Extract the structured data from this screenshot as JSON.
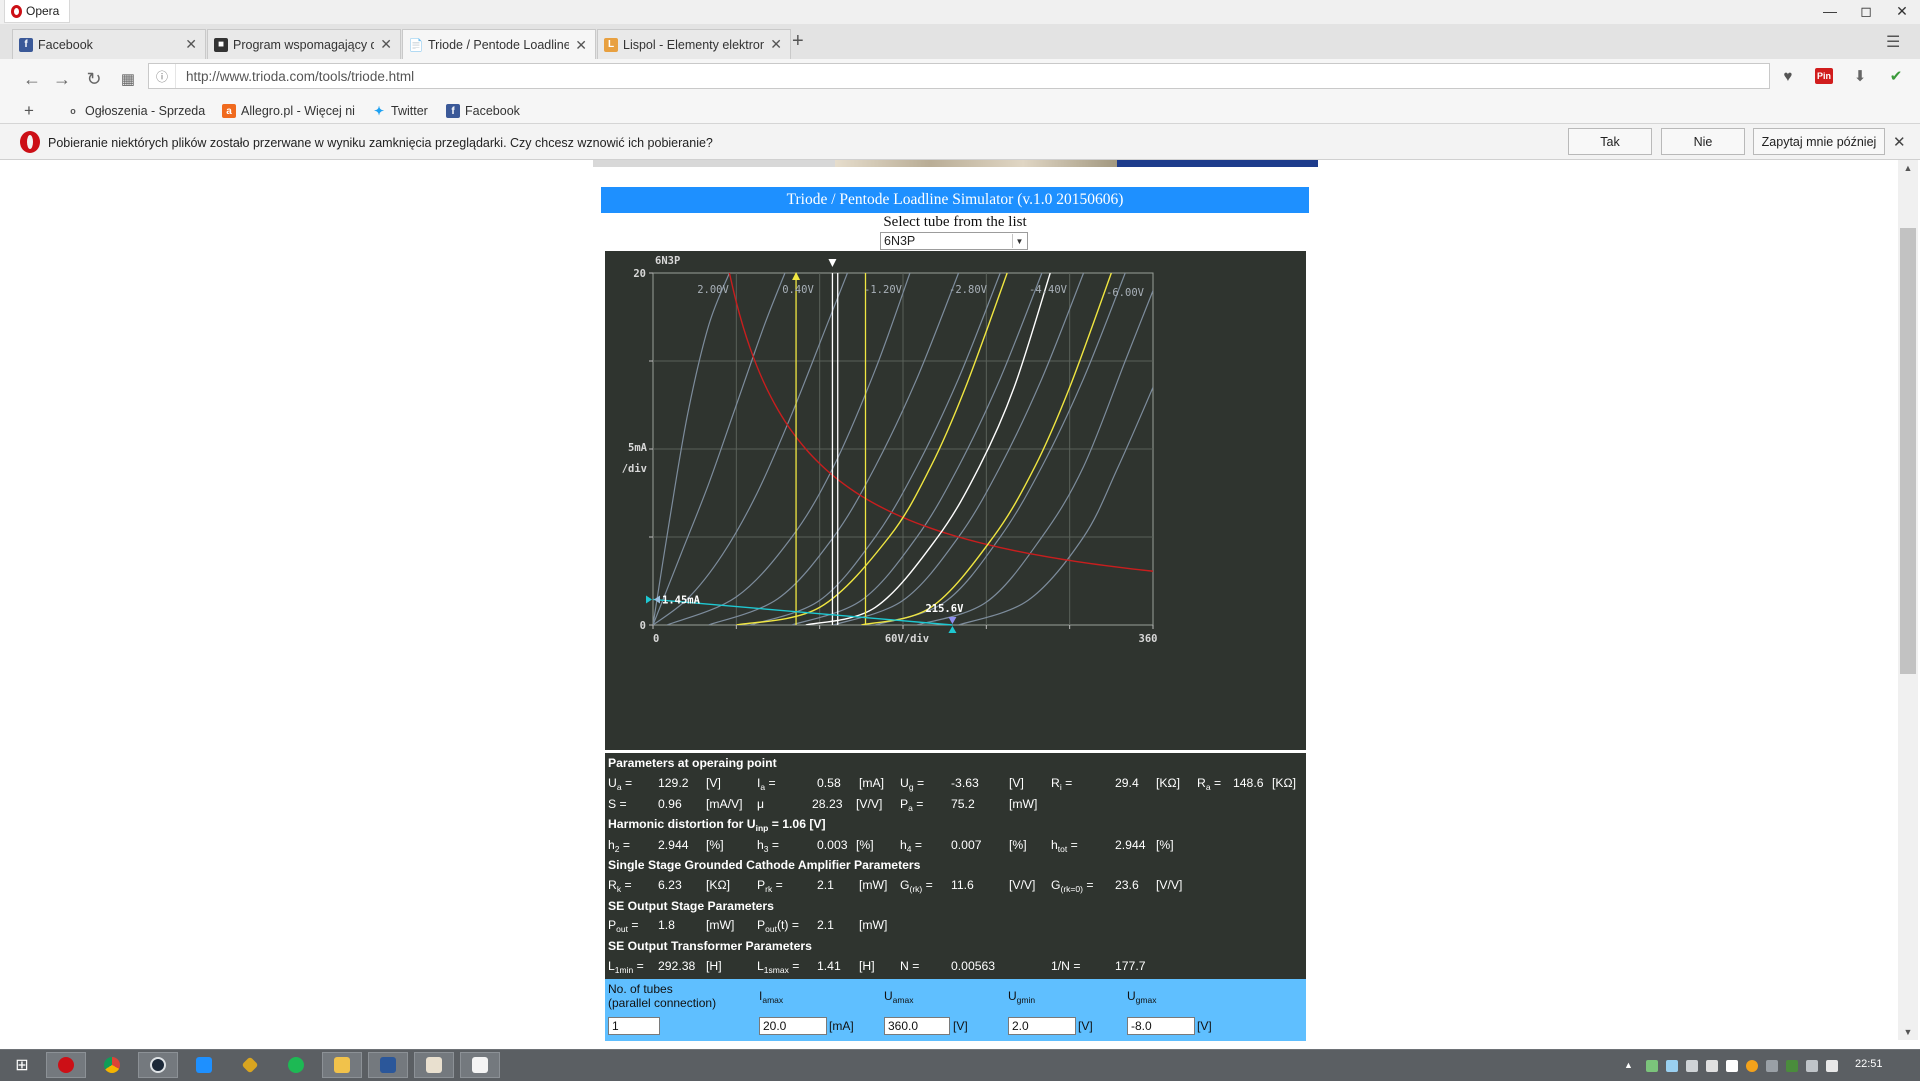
{
  "browser": {
    "menu_label": "Opera",
    "window_controls": [
      "minimize-icon",
      "maximize-icon",
      "close-icon"
    ],
    "tabs": [
      {
        "label": "Facebook",
        "icon": "facebook-icon",
        "active": false
      },
      {
        "label": "Program wspomagający d",
        "icon": "app-icon",
        "active": false
      },
      {
        "label": "Triode / Pentode Loadline",
        "icon": "page-icon",
        "active": true
      },
      {
        "label": "Lispol - Elementy elektron",
        "icon": "lispol-icon",
        "active": false
      }
    ],
    "url": "http://www.trioda.com/tools/triode.html",
    "bookmarks": [
      {
        "label": "Ogłoszenia - Sprzeda",
        "icon": "olx-icon"
      },
      {
        "label": "Allegro.pl - Więcej ni",
        "icon": "allegro-icon"
      },
      {
        "label": "Twitter",
        "icon": "twitter-icon"
      },
      {
        "label": "Facebook",
        "icon": "facebook-icon"
      }
    ],
    "notification": {
      "text": "Pobieranie niektórych plików zostało przerwane w wyniku zamknięcia przeglądarki. Czy chcesz wznowić ich pobieranie?",
      "buttons": {
        "yes": "Tak",
        "no": "Nie",
        "later": "Zapytaj mnie później"
      }
    }
  },
  "simulator": {
    "title": "Triode / Pentode Loadline Simulator (v.1.0 20150606)",
    "select_label": "Select tube from the list",
    "selected_tube": "6N3P",
    "colors": {
      "header": "#1e90ff",
      "panel": "#2f342f",
      "inputs": "#5fbfff",
      "loadline": "#c81e1e",
      "curves": "#7d8c9c",
      "limits": "#f0e641",
      "operating": "#ffffff",
      "acline": "#1ec8d2"
    }
  },
  "chart_data": {
    "type": "line",
    "title": "6N3P",
    "x_unit_label": "60V/div",
    "y_unit_label_1": "5mA",
    "y_unit_label_2": "/div",
    "xlim": [
      0,
      360
    ],
    "ylim": [
      0,
      20
    ],
    "x_tick_labels": [
      "0",
      "360"
    ],
    "y_tick_labels": [
      "0",
      "20"
    ],
    "grid": true,
    "grid_labels": [
      "2.00V",
      "0.40V",
      "-1.20V",
      "-2.80V",
      "-4.40V",
      "-6.00V"
    ],
    "plate_curves": [
      {
        "grid_v": 2.0,
        "points": [
          [
            0,
            0
          ],
          [
            12,
            6
          ],
          [
            25,
            12
          ],
          [
            40,
            17
          ],
          [
            55,
            20
          ]
        ]
      },
      {
        "grid_v": 1.2,
        "points": [
          [
            0,
            0
          ],
          [
            20,
            4
          ],
          [
            40,
            8
          ],
          [
            60,
            12.5
          ],
          [
            80,
            17
          ],
          [
            95,
            20
          ]
        ]
      },
      {
        "grid_v": 0.4,
        "points": [
          [
            0,
            0
          ],
          [
            25,
            1.5
          ],
          [
            50,
            4
          ],
          [
            75,
            7.5
          ],
          [
            100,
            12
          ],
          [
            125,
            17
          ],
          [
            140,
            20
          ]
        ]
      },
      {
        "grid_v": -0.4,
        "points": [
          [
            10,
            0
          ],
          [
            60,
            1.6
          ],
          [
            100,
            5
          ],
          [
            130,
            9
          ],
          [
            160,
            14.5
          ],
          [
            185,
            20
          ]
        ]
      },
      {
        "grid_v": -1.2,
        "points": [
          [
            40,
            0
          ],
          [
            90,
            1.5
          ],
          [
            130,
            5
          ],
          [
            160,
            9
          ],
          [
            190,
            14
          ],
          [
            220,
            20
          ]
        ]
      },
      {
        "grid_v": -2.0,
        "points": [
          [
            70,
            0
          ],
          [
            120,
            1.4
          ],
          [
            160,
            5
          ],
          [
            190,
            9
          ],
          [
            220,
            14
          ],
          [
            250,
            20
          ]
        ]
      },
      {
        "grid_v": -2.8,
        "points": [
          [
            100,
            0
          ],
          [
            150,
            1.4
          ],
          [
            190,
            5
          ],
          [
            220,
            9
          ],
          [
            250,
            14
          ],
          [
            280,
            20
          ]
        ]
      },
      {
        "grid_v": -3.6,
        "points": [
          [
            130,
            0
          ],
          [
            180,
            1.4
          ],
          [
            220,
            5
          ],
          [
            250,
            9
          ],
          [
            280,
            14
          ],
          [
            310,
            20
          ]
        ]
      },
      {
        "grid_v": -4.4,
        "points": [
          [
            160,
            0
          ],
          [
            210,
            1.3
          ],
          [
            250,
            5
          ],
          [
            280,
            9
          ],
          [
            310,
            14
          ],
          [
            340,
            20
          ]
        ]
      },
      {
        "grid_v": -5.2,
        "points": [
          [
            190,
            0
          ],
          [
            240,
            1.3
          ],
          [
            280,
            5
          ],
          [
            310,
            9
          ],
          [
            340,
            15
          ],
          [
            360,
            19
          ]
        ]
      },
      {
        "grid_v": -6.0,
        "points": [
          [
            220,
            0
          ],
          [
            270,
            1.4
          ],
          [
            310,
            5
          ],
          [
            335,
            9
          ],
          [
            360,
            13.5
          ]
        ]
      }
    ],
    "highlight_curves": [
      {
        "role": "umax-limit",
        "points": [
          [
            60,
            0
          ],
          [
            120,
            1
          ],
          [
            170,
            5
          ],
          [
            200,
            9
          ],
          [
            225,
            13.5
          ],
          [
            255,
            20
          ]
        ]
      },
      {
        "role": "operating",
        "points": [
          [
            110,
            0
          ],
          [
            160,
            1
          ],
          [
            205,
            5
          ],
          [
            235,
            9
          ],
          [
            260,
            13.5
          ],
          [
            286,
            20
          ]
        ]
      },
      {
        "role": "umin-limit",
        "points": [
          [
            150,
            0
          ],
          [
            200,
            1
          ],
          [
            245,
            5
          ],
          [
            275,
            9
          ],
          [
            300,
            13.5
          ],
          [
            330,
            20
          ]
        ]
      }
    ],
    "vertical_lines": [
      {
        "role": "umax-limit",
        "x": 103
      },
      {
        "role": "operating",
        "x": 129.2
      },
      {
        "role": "operating",
        "x": 133
      },
      {
        "role": "umin-limit",
        "x": 153
      }
    ],
    "power_hyperbola_mw": 1100,
    "ac_loadline": {
      "points": [
        [
          0,
          1.45
        ],
        [
          215.6,
          0
        ]
      ]
    },
    "markers": {
      "current_label": "1.45mA",
      "current_value": 1.45,
      "voltage_label": "215.6V",
      "voltage_value": 215.6,
      "bias_x": 129.2,
      "top_marker_x": 103
    }
  },
  "params": {
    "sec1_title": "Parameters at operaing point",
    "ua_l": "U",
    "ua_s": "a",
    "ua_eq": "=",
    "ua_v": "129.2",
    "ua_u": "[V]",
    "ia_l": "I",
    "ia_s": "a",
    "ia_eq": "=",
    "ia_v": "0.58",
    "ia_u": "[mA]",
    "ug_l": "U",
    "ug_s": "g",
    "ug_eq": "=",
    "ug_v": "-3.63",
    "ug_u": "[V]",
    "ri_l": "R",
    "ri_s": "i",
    "ri_eq": "=",
    "ri_v": "29.4",
    "ri_u": "[KΩ]",
    "ra_l": "R",
    "ra_s": "a",
    "ra_eq": "=",
    "ra_v": "148.6",
    "ra_u": "[KΩ]",
    "s_l": "S =",
    "s_v": "0.96",
    "s_u": "[mA/V]",
    "mu_l": "μ",
    "mu_v": "28.23",
    "mu_u": "[V/V]",
    "pa_l": "P",
    "pa_s": "a",
    "pa_eq": "=",
    "pa_v": "75.2",
    "pa_u": "[mW]",
    "sec2_pre": "Harmonic distortion for U",
    "sec2_sub": "inp",
    "sec2_post": " = 1.06 [V]",
    "h2_l": "h",
    "h2_s": "2",
    "h2_eq": "=",
    "h2_v": "2.944",
    "h2_u": "[%]",
    "h3_l": "h",
    "h3_s": "3",
    "h3_eq": "=",
    "h3_v": "0.003",
    "h3_u": "[%]",
    "h4_l": "h",
    "h4_s": "4",
    "h4_eq": "=",
    "h4_v": "0.007",
    "h4_u": "[%]",
    "ht_l": "h",
    "ht_s": "tot",
    "ht_eq": "=",
    "ht_v": "2.944",
    "ht_u": "[%]",
    "sec3_title": "Single Stage Grounded Cathode Amplifier Parameters",
    "rk_l": "R",
    "rk_s": "k",
    "rk_eq": "=",
    "rk_v": "6.23",
    "rk_u": "[KΩ]",
    "prk_l": "P",
    "prk_s": "rk",
    "prk_eq": "=",
    "prk_v": "2.1",
    "prk_u": "[mW]",
    "grk_l": "G",
    "grk_s": "(rk)",
    "grk_eq": "=",
    "grk_v": "11.6",
    "grk_u": "[V/V]",
    "grk0_l": "G",
    "grk0_s": "(rk=0)",
    "grk0_eq": "=",
    "grk0_v": "23.6",
    "grk0_u": "[V/V]",
    "sec4_title": "SE Output Stage Parameters",
    "pout_l": "P",
    "pout_s": "out",
    "pout_eq": "=",
    "pout_v": "1.8",
    "pout_u": "[mW]",
    "poutt_l": "P",
    "poutt_s": "out",
    "poutt_eq": "(t) =",
    "poutt_v": "2.1",
    "poutt_u": "[mW]",
    "sec5_title": "SE Output Transformer Parameters",
    "l1_l": "L",
    "l1_s": "1min",
    "l1_eq": "=",
    "l1_v": "292.38",
    "l1_u": "[H]",
    "l1s_l": "L",
    "l1s_s": "1smax",
    "l1s_eq": "=",
    "l1s_v": "1.41",
    "l1s_u": "[H]",
    "n_l": "N =",
    "n_v": "0.00563",
    "invn_l": "1/N =",
    "invn_v": "177.7"
  },
  "inputs": {
    "tubes_label_1": "No. of tubes",
    "tubes_label_2": "(parallel connection)",
    "tubes_value": "1",
    "iamax_l": "I",
    "iamax_s": "amax",
    "iamax_value": "20.0",
    "iamax_unit": "[mA]",
    "uamax_l": "U",
    "uamax_s": "amax",
    "uamax_value": "360.0",
    "uamax_unit": "[V]",
    "ugmin_l": "U",
    "ugmin_s": "gmin",
    "ugmin_value": "2.0",
    "ugmin_unit": "[V]",
    "ugmax_l": "U",
    "ugmax_s": "gmax",
    "ugmax_value": "-8.0",
    "ugmax_unit": "[V]"
  },
  "taskbar": {
    "clock": "22:51",
    "items": [
      "windows-start-icon",
      "opera-icon",
      "chrome-icon",
      "steam-icon",
      "twitch-icon",
      "app-icon",
      "spotify-icon",
      "explorer-icon",
      "word-icon",
      "file-icon",
      "notepad-icon"
    ]
  }
}
